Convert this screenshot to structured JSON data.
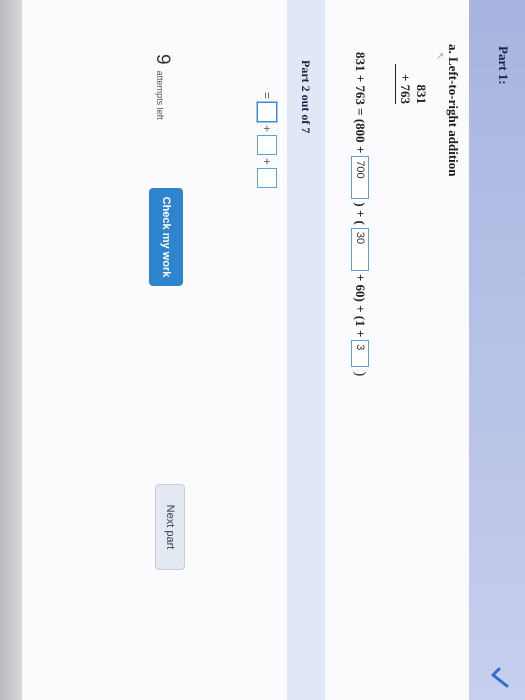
{
  "part1": {
    "title": "Part 1:",
    "heading": "a. Left-to-right addition",
    "addend1": "831",
    "addend2": "+ 763"
  },
  "equation": {
    "lhs": "831 + 763 = (800 +",
    "box1": "700",
    "mid1": ") + (",
    "box2": "30",
    "mid2": "+ 60) + (1 +",
    "box3": "3",
    "end": ")"
  },
  "part2": {
    "title": "Part 2 out of 7",
    "equals": "=",
    "plus": "+"
  },
  "footer": {
    "attempts_count": "9",
    "attempts_label": "attempts left",
    "check_label": "Check my work",
    "next_label": "Next part"
  },
  "icons": {
    "collapse": "check-mark-icon"
  },
  "colors": {
    "accent": "#2f84cf",
    "header": "#a7b4df",
    "part2_bar": "#e0e8f7",
    "check_mark": "#2c6fd0"
  }
}
